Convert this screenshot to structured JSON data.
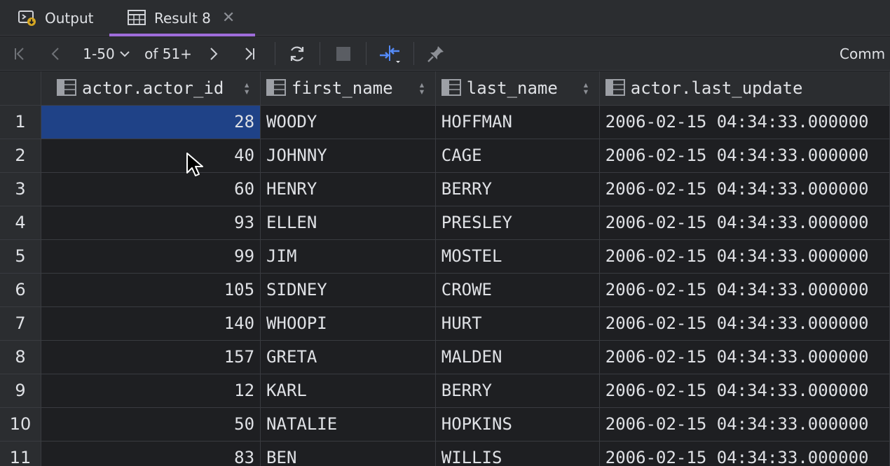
{
  "tabs": [
    {
      "label": "Output",
      "icon": "console-output-icon"
    },
    {
      "label": "Result 8",
      "icon": "table-icon"
    }
  ],
  "toolbar": {
    "page_range": "1-50",
    "total": "of 51+",
    "right_label": "Comm"
  },
  "columns": [
    {
      "label": "actor.actor_id"
    },
    {
      "label": "first_name"
    },
    {
      "label": "last_name"
    },
    {
      "label": "actor.last_update"
    }
  ],
  "rows": [
    {
      "n": "1",
      "id": "28",
      "first": "WOODY",
      "last": "HOFFMAN",
      "upd": "2006-02-15 04:34:33.000000"
    },
    {
      "n": "2",
      "id": "40",
      "first": "JOHNNY",
      "last": "CAGE",
      "upd": "2006-02-15 04:34:33.000000"
    },
    {
      "n": "3",
      "id": "60",
      "first": "HENRY",
      "last": "BERRY",
      "upd": "2006-02-15 04:34:33.000000"
    },
    {
      "n": "4",
      "id": "93",
      "first": "ELLEN",
      "last": "PRESLEY",
      "upd": "2006-02-15 04:34:33.000000"
    },
    {
      "n": "5",
      "id": "99",
      "first": "JIM",
      "last": "MOSTEL",
      "upd": "2006-02-15 04:34:33.000000"
    },
    {
      "n": "6",
      "id": "105",
      "first": "SIDNEY",
      "last": "CROWE",
      "upd": "2006-02-15 04:34:33.000000"
    },
    {
      "n": "7",
      "id": "140",
      "first": "WHOOPI",
      "last": "HURT",
      "upd": "2006-02-15 04:34:33.000000"
    },
    {
      "n": "8",
      "id": "157",
      "first": "GRETA",
      "last": "MALDEN",
      "upd": "2006-02-15 04:34:33.000000"
    },
    {
      "n": "9",
      "id": "12",
      "first": "KARL",
      "last": "BERRY",
      "upd": "2006-02-15 04:34:33.000000"
    },
    {
      "n": "10",
      "id": "50",
      "first": "NATALIE",
      "last": "HOPKINS",
      "upd": "2006-02-15 04:34:33.000000"
    },
    {
      "n": "11",
      "id": "83",
      "first": "BEN",
      "last": "WILLIS",
      "upd": "2006-02-15 04:34:33.000000"
    }
  ],
  "colors": {
    "accent_tab": "#9f6ddb",
    "selection": "#1f4287",
    "compare_icon": "#548af7"
  }
}
